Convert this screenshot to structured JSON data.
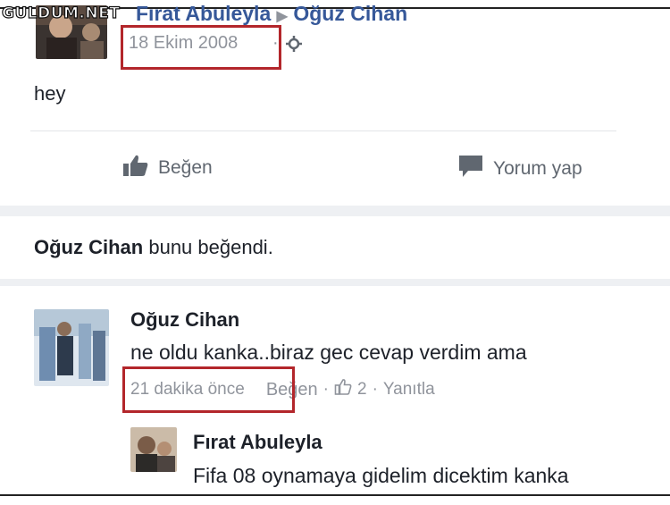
{
  "watermark": "GULDUM.NET",
  "post": {
    "author": "Fırat Abuleyla",
    "arrow": "▶",
    "target": "Oğuz Cihan",
    "date": "18 Ekim 2008",
    "dot": "·",
    "text": "hey",
    "like_label": "Beğen",
    "comment_label": "Yorum yap"
  },
  "activity": {
    "name": "Oğuz Cihan",
    "text": "bunu beğendi."
  },
  "comments": [
    {
      "author": "Oğuz Cihan",
      "text": "ne oldu kanka..biraz gec cevap verdim ama",
      "time": "21 dakika önce",
      "like_label": "Beğen",
      "like_count": "2",
      "reply_label": "Yanıtla"
    },
    {
      "author": "Fırat Abuleyla",
      "text": "Fifa 08 oynamaya gidelim dicektim kanka"
    }
  ],
  "colors": {
    "highlight": "#b3262b",
    "link": "#365899",
    "meta": "#90949c"
  }
}
